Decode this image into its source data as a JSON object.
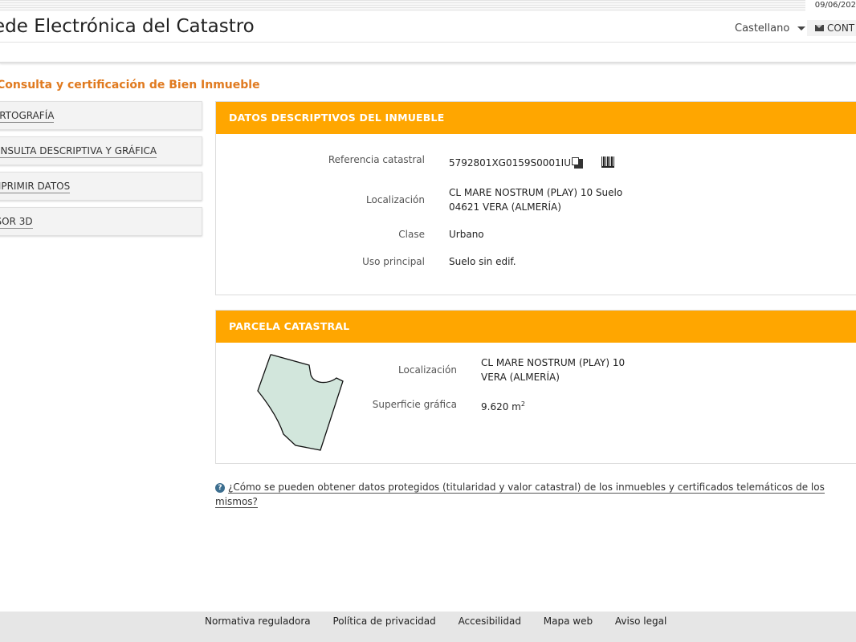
{
  "header": {
    "date": "09/06/202",
    "site_title": "ede Electrónica del Catastro",
    "language": "Castellano",
    "contact": "CONT"
  },
  "page_heading": "Consulta y certificación de Bien Inmueble",
  "sidebar": {
    "items": [
      {
        "label": "ARTOGRAFÍA"
      },
      {
        "label": "ONSULTA DESCRIPTIVA Y GRÁFICA"
      },
      {
        "label": "MPRIMIR DATOS"
      },
      {
        "label": "ISOR 3D"
      }
    ]
  },
  "datos": {
    "title": "DATOS DESCRIPTIVOS DEL INMUEBLE",
    "ref_label": "Referencia catastral",
    "ref_value": "5792801XG0159S0001IU",
    "loc_label": "Localización",
    "loc_line1": "CL MARE NOSTRUM (PLAY) 10 Suelo",
    "loc_line2": "04621 VERA (ALMERÍA)",
    "clase_label": "Clase",
    "clase_value": "Urbano",
    "uso_label": "Uso principal",
    "uso_value": "Suelo sin edif."
  },
  "parcela": {
    "title": "PARCELA CATASTRAL",
    "loc_label": "Localización",
    "loc_line1": "CL MARE NOSTRUM (PLAY) 10",
    "loc_line2": "VERA (ALMERÍA)",
    "sup_label": "Superficie gráfica",
    "sup_value": "9.620 m",
    "sup_unit_sup": "2",
    "shape_fill": "#d2e6dc"
  },
  "help": {
    "icon": "?",
    "text": "¿Cómo se pueden obtener datos protegidos (titularidad y valor catastral) de los inmuebles y certificados telemáticos de los mismos?"
  },
  "footer": {
    "links": [
      "Normativa reguladora",
      "Política de privacidad",
      "Accesibilidad",
      "Mapa web",
      "Aviso legal"
    ]
  },
  "colors": {
    "accent": "#ffa600",
    "heading": "#e07a1f"
  }
}
